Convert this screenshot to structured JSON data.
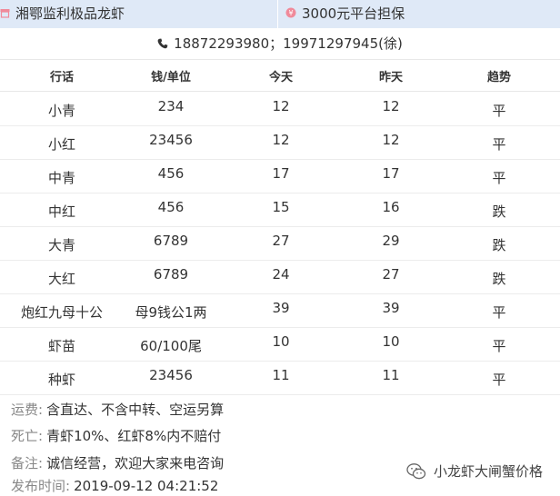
{
  "header": {
    "left_title": "湘鄂监利极品龙虾",
    "right_title": "3000元平台担保",
    "left_icon": "store-icon",
    "right_icon": "shield-icon"
  },
  "contact": {
    "phone_text": "18872293980；19971297945(徐)",
    "icon": "phone-icon"
  },
  "table": {
    "columns": [
      "行话",
      "钱/单位",
      "今天",
      "昨天",
      "趋势"
    ],
    "rows": [
      {
        "name": "小青",
        "price": "234",
        "today": "12",
        "yesterday": "12",
        "trend": "平"
      },
      {
        "name": "小红",
        "price": "23456",
        "today": "12",
        "yesterday": "12",
        "trend": "平"
      },
      {
        "name": "中青",
        "price": "456",
        "today": "17",
        "yesterday": "17",
        "trend": "平"
      },
      {
        "name": "中红",
        "price": "456",
        "today": "15",
        "yesterday": "16",
        "trend": "跌"
      },
      {
        "name": "大青",
        "price": "6789",
        "today": "27",
        "yesterday": "29",
        "trend": "跌"
      },
      {
        "name": "大红",
        "price": "6789",
        "today": "24",
        "yesterday": "27",
        "trend": "跌"
      },
      {
        "name": "炮红九母十公",
        "price": "母9钱公1两",
        "today": "39",
        "yesterday": "39",
        "trend": "平"
      },
      {
        "name": "虾苗",
        "price": "60/100尾",
        "today": "10",
        "yesterday": "10",
        "trend": "平"
      },
      {
        "name": "种虾",
        "price": "23456",
        "today": "11",
        "yesterday": "11",
        "trend": "平"
      }
    ]
  },
  "notes": {
    "shipping_label": "运费:",
    "shipping_value": "含直达、不含中转、空运另算",
    "death_label": "死亡:",
    "death_value": "青虾10%、红虾8%内不赔付",
    "remark_label": "备注:",
    "remark_value": "诚信经营，欢迎大家来电咨询",
    "publish_label": "发布时间:",
    "publish_value": "2019-09-12 04:21:52"
  },
  "watermark": {
    "text": "小龙虾大闸蟹价格",
    "icon": "wechat-icon"
  },
  "colors": {
    "header_bg": "#dfe9f7",
    "icon_pink": "#f08a9a",
    "divider": "#e8e8e8"
  }
}
